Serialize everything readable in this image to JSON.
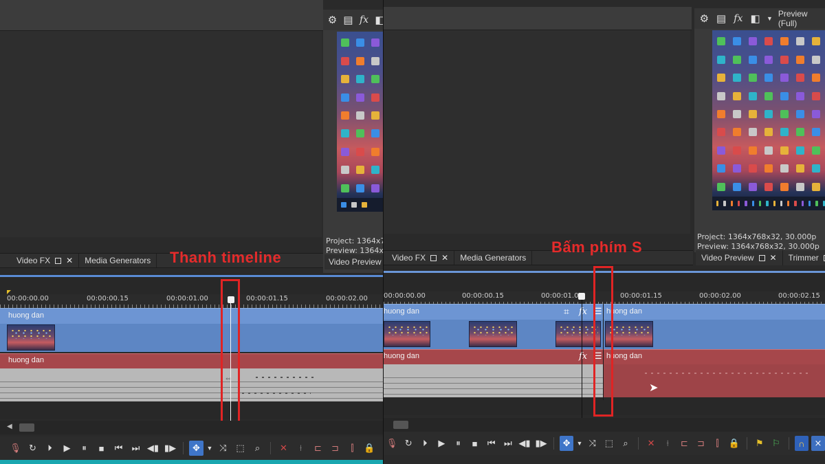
{
  "left": {
    "preview_toolbar_icons": [
      "gear-icon",
      "printer-icon",
      "fx-icon",
      "split-screen-icon"
    ],
    "preview_info": {
      "project": "Project:  1364x7",
      "preview": "Preview:  1364x7"
    },
    "tabs": [
      {
        "label": "Video FX",
        "has_window_icon": true,
        "has_close": true
      },
      {
        "label": "Media Generators",
        "has_window_icon": false,
        "has_close": false
      }
    ],
    "side_tab": {
      "label": "Video Preview"
    },
    "annotation": "Thanh timeline",
    "ruler_labels": [
      "00:00:00.00",
      "00:00:00.15",
      "00:00:01.00",
      "00:00:01.15",
      "00:00:02.00"
    ],
    "video_track": {
      "clip_name": "huong dan"
    },
    "audio_track": {
      "clip_name": "huong dan"
    }
  },
  "right": {
    "preview_toolbar_icons": [
      "gear-icon",
      "printer-icon",
      "fx-icon",
      "split-screen-icon",
      "dropdown-icon"
    ],
    "preview_mode": "Preview (Full)",
    "preview_info": {
      "project": "Project:   1364x768x32, 30.000p",
      "preview": "Preview:  1364x768x32, 30.000p"
    },
    "tabs": [
      {
        "label": "Video FX",
        "has_window_icon": true,
        "has_close": true
      },
      {
        "label": "Media Generators",
        "has_window_icon": false,
        "has_close": false
      }
    ],
    "side_tabs": [
      {
        "label": "Video Preview",
        "has_window_icon": true,
        "has_close": true
      },
      {
        "label": "Trimmer",
        "has_window_icon": true,
        "has_close": false
      }
    ],
    "annotation": "Bấm phím S",
    "ruler_labels": [
      "00:00:00.00",
      "00:00:00.15",
      "00:00:01.00",
      "00:00:01.15",
      "00:00:02.00",
      "00:00:02.15"
    ],
    "video_track": {
      "clip_name_left": "huong dan",
      "clip_name_right": "huong dan"
    },
    "audio_track": {
      "clip_name_left": "huong dan",
      "clip_name_right": "huong dan"
    }
  },
  "colors": {
    "annotation_red": "#e02424",
    "video_track": "#5d86c4",
    "audio_track_header": "#a6474b",
    "active_tool": "#3f75c8",
    "teal_accent": "#1aa7b0"
  }
}
